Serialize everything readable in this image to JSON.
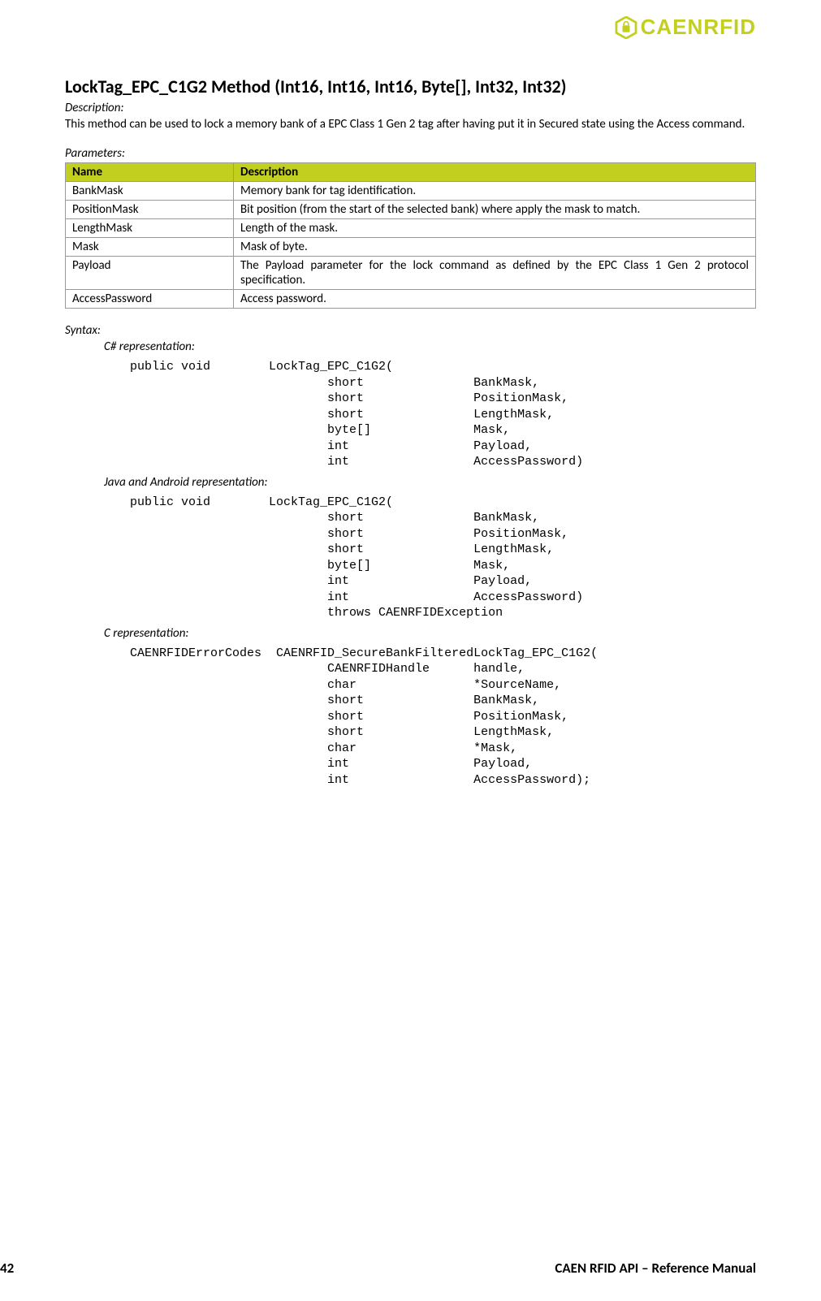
{
  "brand": {
    "name": "CAENRFID"
  },
  "method": {
    "title": "LockTag_EPC_C1G2 Method (Int16, Int16, Int16, Byte[], Int32, Int32)",
    "description_label": "Description:",
    "description": "This method can be used to lock a memory bank of a EPC Class 1 Gen 2 tag after having put it in Secured state using the Access command."
  },
  "parameters": {
    "label": "Parameters:",
    "headers": {
      "name": "Name",
      "description": "Description"
    },
    "rows": [
      {
        "name": "BankMask",
        "desc": "Memory bank for tag identification."
      },
      {
        "name": "PositionMask",
        "desc": "Bit position (from the start of the selected bank) where apply the mask to match."
      },
      {
        "name": "LengthMask",
        "desc": "Length of the mask."
      },
      {
        "name": "Mask",
        "desc": "Mask of byte."
      },
      {
        "name": "Payload",
        "desc": "The Payload parameter for the lock command as defined by the EPC Class 1 Gen 2 protocol specification."
      },
      {
        "name": "AccessPassword",
        "desc": "Access password."
      }
    ]
  },
  "syntax": {
    "label": "Syntax:",
    "csharp_label": "C# representation:",
    "csharp_code": "public void        LockTag_EPC_C1G2(\n                           short               BankMask,\n                           short               PositionMask,\n                           short               LengthMask,\n                           byte[]              Mask,\n                           int                 Payload,\n                           int                 AccessPassword)",
    "java_label": "Java and Android representation:",
    "java_code": "public void        LockTag_EPC_C1G2(\n                           short               BankMask,\n                           short               PositionMask,\n                           short               LengthMask,\n                           byte[]              Mask,\n                           int                 Payload,\n                           int                 AccessPassword)\n                           throws CAENRFIDException",
    "c_label": "C representation:",
    "c_code": "CAENRFIDErrorCodes  CAENRFID_SecureBankFilteredLockTag_EPC_C1G2(\n                           CAENRFIDHandle      handle,\n                           char                *SourceName,\n                           short               BankMask,\n                           short               PositionMask,\n                           short               LengthMask,\n                           char                *Mask,\n                           int                 Payload,\n                           int                 AccessPassword);"
  },
  "footer": {
    "page": "42",
    "title": "CAEN RFID API – Reference Manual"
  }
}
